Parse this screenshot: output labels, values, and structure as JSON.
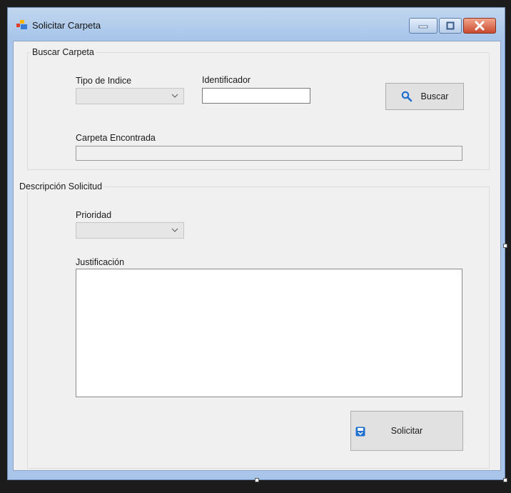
{
  "window": {
    "title": "Solicitar Carpeta"
  },
  "buscar_group": {
    "legend": "Buscar Carpeta",
    "tipo_indice_label": "Tipo de Indice",
    "identificador_label": "Identificador",
    "identificador_value": "",
    "buscar_button": "Buscar",
    "carpeta_encontrada_label": "Carpeta Encontrada",
    "carpeta_encontrada_value": ""
  },
  "descripcion_group": {
    "legend": "Descripción Solicitud",
    "prioridad_label": "Prioridad",
    "justificacion_label": "Justificación",
    "justificacion_value": "",
    "solicitar_button": "Solicitar"
  },
  "icons": {
    "app": "app-window-icon",
    "buscar": "search-icon",
    "solicitar": "save-icon",
    "combo_arrow": "chevron-down-icon"
  },
  "colors": {
    "titlebar": "#a9c6ea",
    "close_button": "#c94a2f",
    "client_bg": "#f0f0f0",
    "accent_icon": "#1e6fd0"
  }
}
